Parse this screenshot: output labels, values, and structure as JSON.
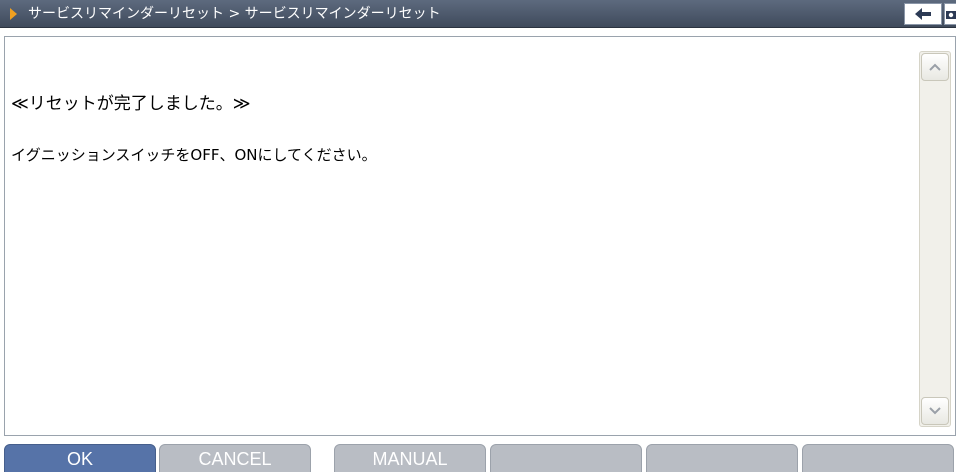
{
  "title": {
    "breadcrumb": "サービスリマインダーリセット > サービスリマインダーリセット"
  },
  "icons": {
    "title_marker": "play-arrow-icon",
    "back": "back-arrow-icon",
    "snapshot": "camera-icon",
    "scroll_up": "chevron-up-icon",
    "scroll_down": "chevron-down-icon"
  },
  "content": {
    "message_title": "≪リセットが完了しました。≫",
    "message_body": "イグニッションスイッチをOFF、ONにしてください。"
  },
  "buttons": {
    "ok": "OK",
    "cancel": "CANCEL",
    "manual": "MANUAL",
    "f4": "",
    "f5": "",
    "f6": ""
  },
  "colors": {
    "titlebar": "#4a5568",
    "active_button": "#5673a8",
    "inactive_button": "#b9bdc4",
    "title_marker": "#f0a020"
  }
}
